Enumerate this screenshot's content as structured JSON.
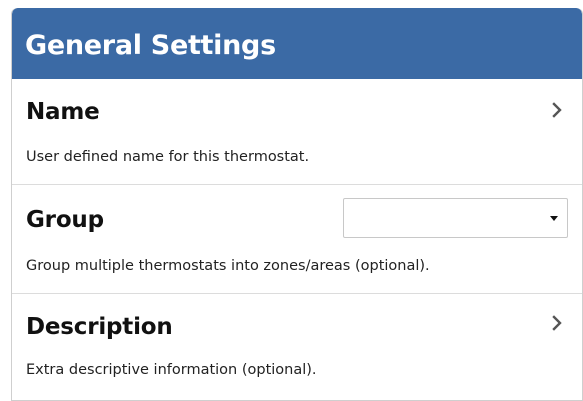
{
  "header": {
    "title": "General Settings"
  },
  "settings": [
    {
      "title": "Name",
      "description": "User defined name for this thermostat.",
      "control": "chevron"
    },
    {
      "title": "Group",
      "description": "Group multiple thermostats into zones/areas (optional).",
      "control": "select",
      "selected_value": ""
    },
    {
      "title": "Description",
      "description": "Extra descriptive information (optional).",
      "control": "chevron"
    }
  ],
  "icons": {
    "chevron": "chevron-right-icon",
    "dropdown": "caret-down-icon"
  },
  "colors": {
    "header_background": "#3b6aa5",
    "header_text": "#ffffff",
    "divider": "#dcdcdc"
  }
}
